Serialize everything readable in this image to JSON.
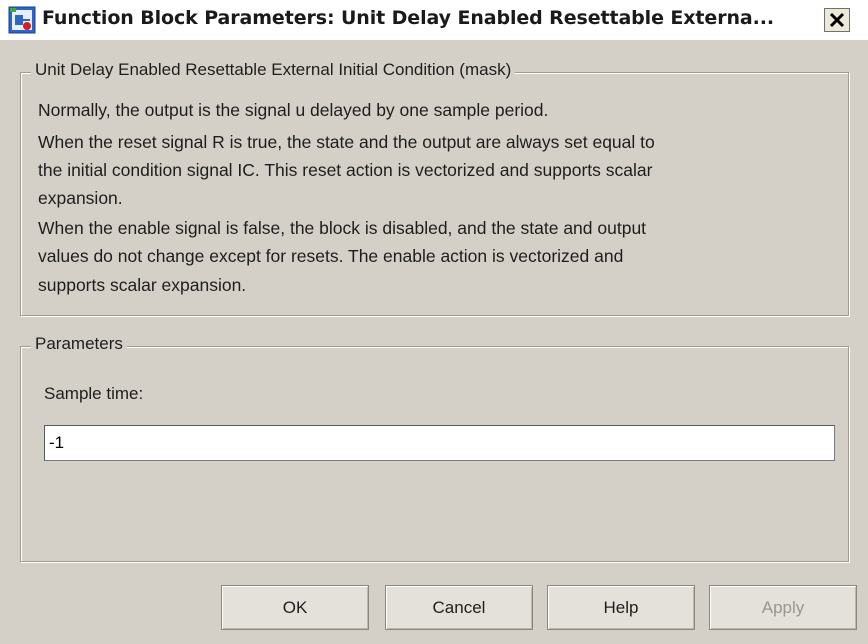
{
  "window": {
    "title": "Function Block Parameters: Unit Delay Enabled Resettable Externa...",
    "icon": "simulink-block-icon",
    "close_icon": "close-icon"
  },
  "description_group": {
    "label": "Unit Delay Enabled Resettable External Initial Condition (mask)",
    "lines": [
      "Normally, the output is the signal u delayed by one sample period.",
      "When the reset signal R is true, the state and the output are always set equal to",
      "the initial condition signal IC.  This reset action is vectorized and supports scalar",
      "expansion.",
      "When the enable signal is false, the block is disabled, and the state and output",
      "values do not change except for resets.  The enable action is vectorized and",
      "supports scalar expansion."
    ]
  },
  "parameters_group": {
    "label": "Parameters",
    "sample_time_label": "Sample time:",
    "sample_time_value": "-1"
  },
  "buttons": {
    "ok": "OK",
    "cancel": "Cancel",
    "help": "Help",
    "apply": "Apply",
    "apply_disabled": true
  }
}
